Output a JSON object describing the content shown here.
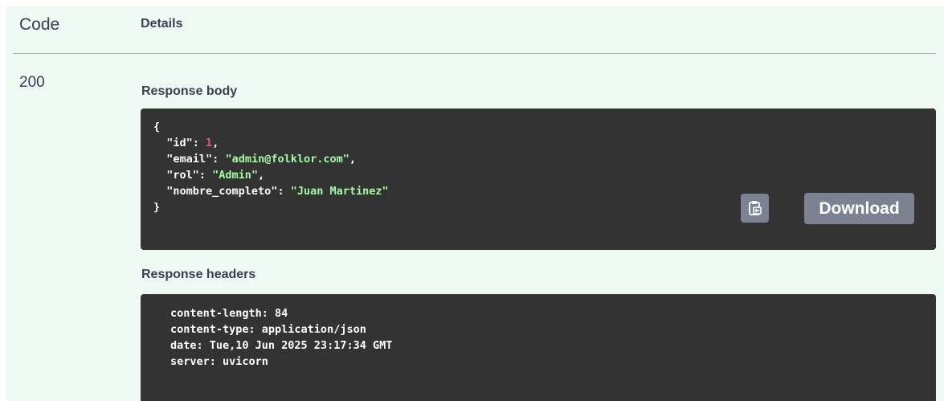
{
  "table": {
    "col_code": "Code",
    "col_details": "Details"
  },
  "response": {
    "code": "200",
    "body_label": "Response body",
    "body": {
      "open": "{",
      "close": "}",
      "fields": [
        {
          "key": "\"id\"",
          "value": "1",
          "type": "number",
          "comma": ","
        },
        {
          "key": "\"email\"",
          "value": "\"admin@folklor.com\"",
          "type": "string",
          "comma": ","
        },
        {
          "key": "\"rol\"",
          "value": "\"Admin\"",
          "type": "string",
          "comma": ","
        },
        {
          "key": "\"nombre_completo\"",
          "value": "\"Juan Martinez\"",
          "type": "string",
          "comma": ""
        }
      ]
    },
    "copy_icon": "clipboard-icon",
    "download_label": "Download",
    "headers_label": "Response headers",
    "headers": [
      "content-length: 84",
      "content-type: application/json",
      "date: Tue,10 Jun 2025 23:17:34 GMT",
      "server: uvicorn"
    ]
  },
  "colors": {
    "panel_bg": "#eefaf3",
    "code_bg": "#333333",
    "number": "#d36363",
    "string": "#a2fca2",
    "button_bg": "#7d8293"
  }
}
